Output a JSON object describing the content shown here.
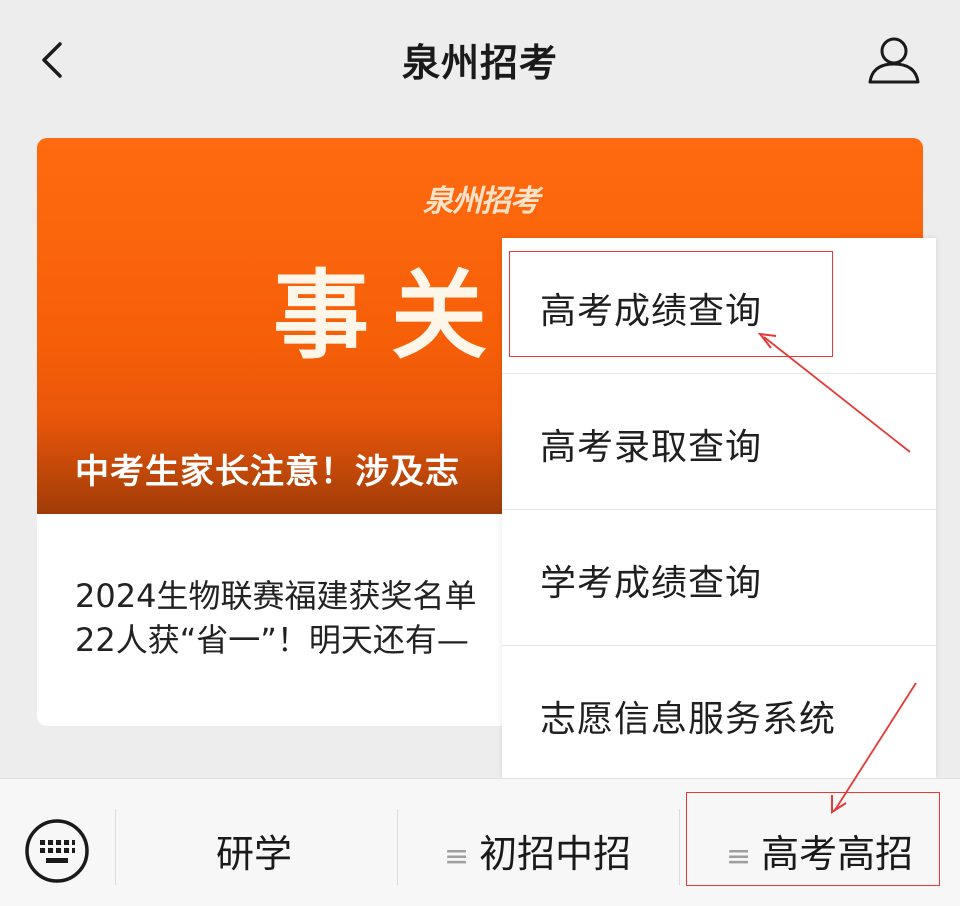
{
  "header": {
    "title": "泉州招考",
    "back_icon": "chevron-left-icon",
    "user_icon": "user-icon"
  },
  "banner": {
    "logo": "泉州招考",
    "big_text": "事关志",
    "caption": "中考生家长注意！涉及志"
  },
  "article": {
    "line1": "2024生物联赛福建获奖名单",
    "line2": "22人获“省一”！明天还有—"
  },
  "menu": {
    "items": [
      {
        "label": "高考成绩查询"
      },
      {
        "label": "高考录取查询"
      },
      {
        "label": "学考成绩查询"
      },
      {
        "label": "志愿信息服务系统"
      }
    ]
  },
  "bottom_nav": {
    "keyboard_icon": "keyboard-icon",
    "tabs": [
      {
        "label": "研学"
      },
      {
        "label": "初招中招",
        "menu_marker": "≡"
      },
      {
        "label": "高考高招",
        "menu_marker": "≡"
      }
    ]
  },
  "colors": {
    "banner_orange": "#f65f08",
    "highlight_red": "#e53935"
  }
}
